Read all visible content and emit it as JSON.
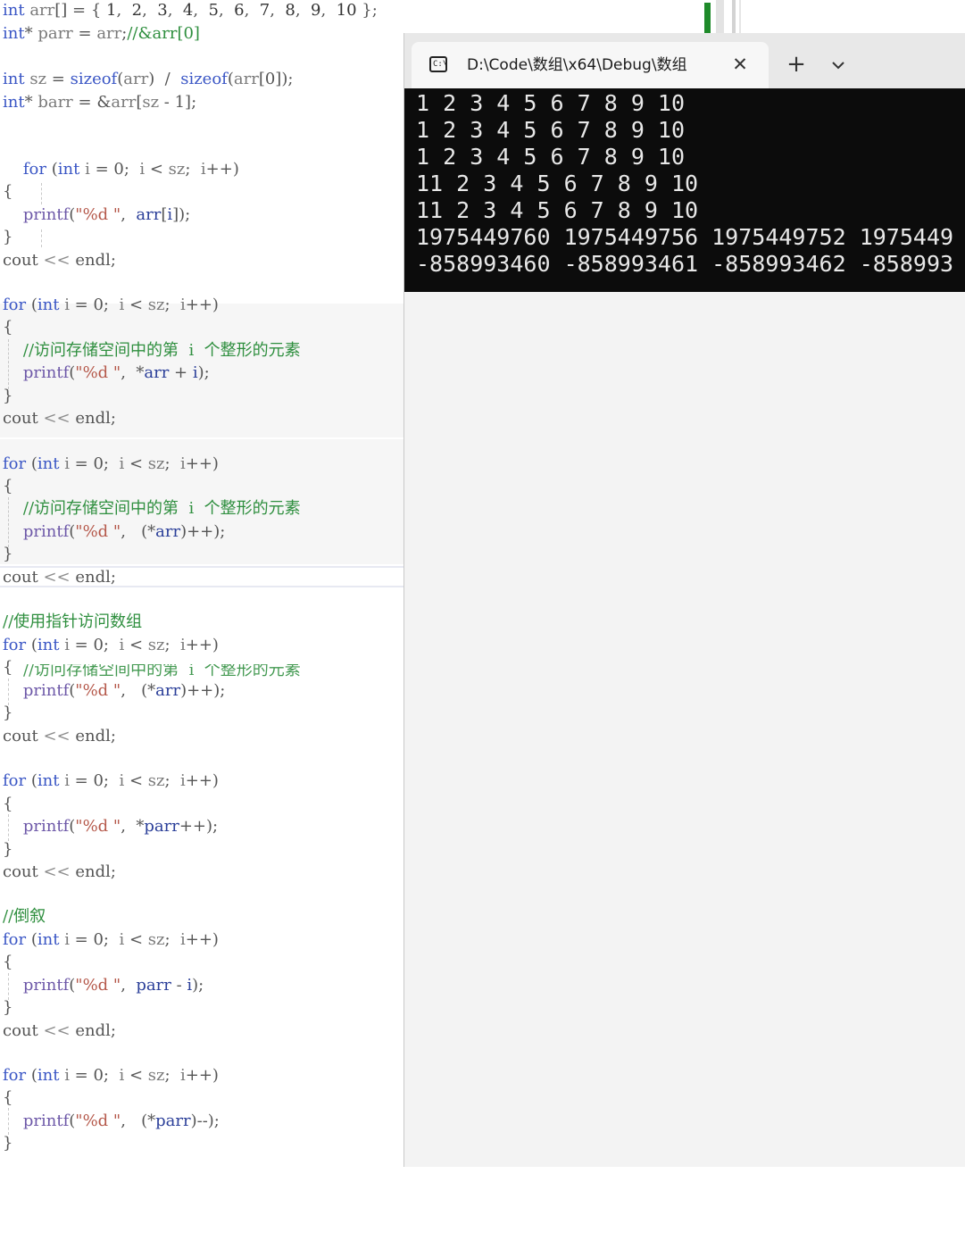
{
  "editor": {
    "lines": [
      [
        [
          "kw",
          "int"
        ],
        [
          "op",
          " "
        ],
        [
          "var",
          "arr"
        ],
        [
          "op",
          "[] = { "
        ],
        [
          "num",
          "1"
        ],
        [
          "op",
          ",  "
        ],
        [
          "num",
          "2"
        ],
        [
          "op",
          ",  "
        ],
        [
          "num",
          "3"
        ],
        [
          "op",
          ",  "
        ],
        [
          "num",
          "4"
        ],
        [
          "op",
          ",  "
        ],
        [
          "num",
          "5"
        ],
        [
          "op",
          ",  "
        ],
        [
          "num",
          "6"
        ],
        [
          "op",
          ",  "
        ],
        [
          "num",
          "7"
        ],
        [
          "op",
          ",  "
        ],
        [
          "num",
          "8"
        ],
        [
          "op",
          ",  "
        ],
        [
          "num",
          "9"
        ],
        [
          "op",
          ",  "
        ],
        [
          "num",
          "10"
        ],
        [
          "op",
          " };"
        ]
      ],
      [
        [
          "kw",
          "int"
        ],
        [
          "op",
          "* "
        ],
        [
          "var",
          "parr"
        ],
        [
          "op",
          " = "
        ],
        [
          "var",
          "arr"
        ],
        [
          "op",
          ";"
        ],
        [
          "cm",
          "//&arr[0]"
        ]
      ],
      [],
      [
        [
          "kw",
          "int"
        ],
        [
          "op",
          " "
        ],
        [
          "var",
          "sz"
        ],
        [
          "op",
          " = "
        ],
        [
          "kw",
          "sizeof"
        ],
        [
          "op",
          "("
        ],
        [
          "var",
          "arr"
        ],
        [
          "op",
          ")  /  "
        ],
        [
          "kw",
          "sizeof"
        ],
        [
          "op",
          "("
        ],
        [
          "var",
          "arr"
        ],
        [
          "op",
          "[0]);"
        ]
      ],
      [
        [
          "kw",
          "int"
        ],
        [
          "op",
          "* "
        ],
        [
          "var",
          "barr"
        ],
        [
          "op",
          " = &"
        ],
        [
          "var",
          "arr"
        ],
        [
          "op",
          "["
        ],
        [
          "var",
          "sz"
        ],
        [
          "op",
          " - 1];"
        ]
      ],
      [],
      [],
      [
        [
          "op",
          "    "
        ],
        [
          "kw",
          "for"
        ],
        [
          "op",
          " ("
        ],
        [
          "kw",
          "int"
        ],
        [
          "op",
          " "
        ],
        [
          "var",
          "i"
        ],
        [
          "op",
          " = 0;  "
        ],
        [
          "var",
          "i"
        ],
        [
          "op",
          " < "
        ],
        [
          "var",
          "sz"
        ],
        [
          "op",
          ";  "
        ],
        [
          "var",
          "i"
        ],
        [
          "op",
          "++)"
        ]
      ],
      [
        [
          "op",
          "{"
        ]
      ],
      [
        [
          "op",
          "    "
        ],
        [
          "fn",
          "printf"
        ],
        [
          "op",
          "("
        ],
        [
          "str",
          "\"%d \""
        ],
        [
          "op",
          ",  "
        ],
        [
          "id",
          "arr"
        ],
        [
          "op",
          "["
        ],
        [
          "id",
          "i"
        ],
        [
          "op",
          "]);"
        ]
      ],
      [
        [
          "op",
          "}"
        ]
      ],
      [
        [
          "op",
          "cout "
        ],
        [
          "dim",
          "<<"
        ],
        [
          "op",
          " endl;"
        ]
      ],
      [],
      [
        [
          "kw",
          "for"
        ],
        [
          "op",
          " ("
        ],
        [
          "kw",
          "int"
        ],
        [
          "op",
          " "
        ],
        [
          "var",
          "i"
        ],
        [
          "op",
          " = 0;  "
        ],
        [
          "var",
          "i"
        ],
        [
          "op",
          " < "
        ],
        [
          "var",
          "sz"
        ],
        [
          "op",
          ";  "
        ],
        [
          "var",
          "i"
        ],
        [
          "op",
          "++)"
        ]
      ],
      [
        [
          "op",
          "{"
        ]
      ],
      [
        [
          "op",
          "    "
        ],
        [
          "cm",
          "//访问存储空间中的第  i  个整形的元素"
        ]
      ],
      [
        [
          "op",
          "    "
        ],
        [
          "fn",
          "printf"
        ],
        [
          "op",
          "("
        ],
        [
          "str",
          "\"%d \""
        ],
        [
          "op",
          ",  *"
        ],
        [
          "id",
          "arr"
        ],
        [
          "op",
          " + "
        ],
        [
          "id",
          "i"
        ],
        [
          "op",
          ");"
        ]
      ],
      [
        [
          "op",
          "}"
        ]
      ],
      [
        [
          "op",
          "cout "
        ],
        [
          "dim",
          "<<"
        ],
        [
          "op",
          " endl;"
        ]
      ],
      [],
      [
        [
          "kw",
          "for"
        ],
        [
          "op",
          " ("
        ],
        [
          "kw",
          "int"
        ],
        [
          "op",
          " "
        ],
        [
          "var",
          "i"
        ],
        [
          "op",
          " = 0;  "
        ],
        [
          "var",
          "i"
        ],
        [
          "op",
          " < "
        ],
        [
          "var",
          "sz"
        ],
        [
          "op",
          ";  "
        ],
        [
          "var",
          "i"
        ],
        [
          "op",
          "++)"
        ]
      ],
      [
        [
          "op",
          "{"
        ]
      ],
      [
        [
          "op",
          "    "
        ],
        [
          "cm",
          "//访问存储空间中的第  i  个整形的元素"
        ]
      ],
      [
        [
          "op",
          "    "
        ],
        [
          "fn",
          "printf"
        ],
        [
          "op",
          "("
        ],
        [
          "str",
          "\"%d \""
        ],
        [
          "op",
          ",   (*"
        ],
        [
          "id",
          "arr"
        ],
        [
          "op",
          ")++);"
        ]
      ],
      [
        [
          "op",
          "}"
        ]
      ],
      [
        [
          "op",
          "cout "
        ],
        [
          "dim",
          "<<"
        ],
        [
          "op",
          " endl;"
        ]
      ],
      [],
      [
        [
          "cm",
          "//使用指针访问数组"
        ]
      ],
      [
        [
          "kw",
          "for"
        ],
        [
          "op",
          " ("
        ],
        [
          "kw",
          "int"
        ],
        [
          "op",
          " "
        ],
        [
          "var",
          "i"
        ],
        [
          "op",
          " = 0;  "
        ],
        [
          "var",
          "i"
        ],
        [
          "op",
          " < "
        ],
        [
          "var",
          "sz"
        ],
        [
          "op",
          ";  "
        ],
        [
          "var",
          "i"
        ],
        [
          "op",
          "++)"
        ]
      ],
      [
        [
          "op",
          "{"
        ]
      ],
      [
        [
          "op",
          "    "
        ],
        [
          "fn",
          "printf"
        ],
        [
          "op",
          "("
        ],
        [
          "str",
          "\"%d \""
        ],
        [
          "op",
          ",   (*"
        ],
        [
          "id",
          "arr"
        ],
        [
          "op",
          ")++);"
        ]
      ],
      [
        [
          "op",
          "}"
        ]
      ],
      [
        [
          "op",
          "cout "
        ],
        [
          "dim",
          "<<"
        ],
        [
          "op",
          " endl;"
        ]
      ],
      [],
      [
        [
          "kw",
          "for"
        ],
        [
          "op",
          " ("
        ],
        [
          "kw",
          "int"
        ],
        [
          "op",
          " "
        ],
        [
          "var",
          "i"
        ],
        [
          "op",
          " = 0;  "
        ],
        [
          "var",
          "i"
        ],
        [
          "op",
          " < "
        ],
        [
          "var",
          "sz"
        ],
        [
          "op",
          ";  "
        ],
        [
          "var",
          "i"
        ],
        [
          "op",
          "++)"
        ]
      ],
      [
        [
          "op",
          "{"
        ]
      ],
      [
        [
          "op",
          "    "
        ],
        [
          "fn",
          "printf"
        ],
        [
          "op",
          "("
        ],
        [
          "str",
          "\"%d \""
        ],
        [
          "op",
          ",  *"
        ],
        [
          "id",
          "parr"
        ],
        [
          "op",
          "++);"
        ]
      ],
      [
        [
          "op",
          "}"
        ]
      ],
      [
        [
          "op",
          "cout "
        ],
        [
          "dim",
          "<<"
        ],
        [
          "op",
          " endl;"
        ]
      ],
      [],
      [
        [
          "cm",
          "//倒叙"
        ]
      ],
      [
        [
          "kw",
          "for"
        ],
        [
          "op",
          " ("
        ],
        [
          "kw",
          "int"
        ],
        [
          "op",
          " "
        ],
        [
          "var",
          "i"
        ],
        [
          "op",
          " = 0;  "
        ],
        [
          "var",
          "i"
        ],
        [
          "op",
          " < "
        ],
        [
          "var",
          "sz"
        ],
        [
          "op",
          ";  "
        ],
        [
          "var",
          "i"
        ],
        [
          "op",
          "++)"
        ]
      ],
      [
        [
          "op",
          "{"
        ]
      ],
      [
        [
          "op",
          "    "
        ],
        [
          "fn",
          "printf"
        ],
        [
          "op",
          "("
        ],
        [
          "str",
          "\"%d \""
        ],
        [
          "op",
          ",  "
        ],
        [
          "id",
          "parr"
        ],
        [
          "op",
          " - "
        ],
        [
          "id",
          "i"
        ],
        [
          "op",
          ");"
        ]
      ],
      [
        [
          "op",
          "}"
        ]
      ],
      [
        [
          "op",
          "cout "
        ],
        [
          "dim",
          "<<"
        ],
        [
          "op",
          " endl;"
        ]
      ],
      [],
      [
        [
          "kw",
          "for"
        ],
        [
          "op",
          " ("
        ],
        [
          "kw",
          "int"
        ],
        [
          "op",
          " "
        ],
        [
          "var",
          "i"
        ],
        [
          "op",
          " = 0;  "
        ],
        [
          "var",
          "i"
        ],
        [
          "op",
          " < "
        ],
        [
          "var",
          "sz"
        ],
        [
          "op",
          ";  "
        ],
        [
          "var",
          "i"
        ],
        [
          "op",
          "++)"
        ]
      ],
      [
        [
          "op",
          "{"
        ]
      ],
      [
        [
          "op",
          "    "
        ],
        [
          "fn",
          "printf"
        ],
        [
          "op",
          "("
        ],
        [
          "str",
          "\"%d \""
        ],
        [
          "op",
          ",   (*"
        ],
        [
          "id",
          "parr"
        ],
        [
          "op",
          ")--);"
        ]
      ],
      [
        [
          "op",
          "}"
        ]
      ]
    ],
    "overlap_comment": "//访问存储空间中的第  i  个整形的元素"
  },
  "terminal": {
    "tab_title": "D:\\Code\\数组\\x64\\Debug\\数组",
    "icon": "console-icon",
    "close_glyph": "✕",
    "new_tab_glyph": "+",
    "output": [
      "1 2 3 4 5 6 7 8 9 10",
      "1 2 3 4 5 6 7 8 9 10",
      "1 2 3 4 5 6 7 8 9 10",
      "11 2 3 4 5 6 7 8 9 10",
      "11 2 3 4 5 6 7 8 9 10",
      "1975449760 1975449756 1975449752 1975449",
      "-858993460 -858993461 -858993462 -858993"
    ]
  },
  "colors": {
    "keyword": "#3a56c5",
    "comment": "#2f8f3f",
    "string": "#b5584a",
    "console_bg": "#0c0c0c",
    "console_fg": "#e8e8e8",
    "scroll_marker": "#1e8a2a"
  }
}
